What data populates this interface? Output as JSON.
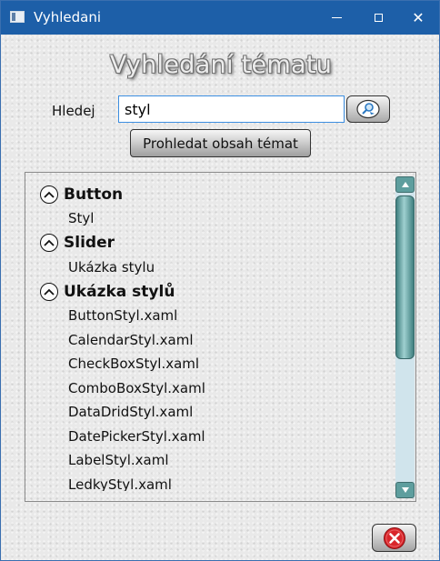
{
  "window": {
    "title": "Vyhledani",
    "controls": {
      "minimize": "minimize",
      "maximize": "maximize",
      "close": "✕"
    }
  },
  "heading": "Vyhledání tématu",
  "search": {
    "label": "Hledej",
    "value": "styl",
    "button_icon": "search-icon"
  },
  "primary_button": "Prohledat obsah témat",
  "tree": {
    "groups": [
      {
        "title": "Button",
        "items": [
          "Styl"
        ]
      },
      {
        "title": "Slider",
        "items": [
          "Ukázka stylu"
        ]
      },
      {
        "title": "Ukázka stylů",
        "items": [
          "ButtonStyl.xaml",
          "CalendarStyl.xaml",
          "CheckBoxStyl.xaml",
          "ComboBoxStyl.xaml",
          "DataDridStyl.xaml",
          "DatePickerStyl.xaml",
          "LabelStyl.xaml",
          "LedkyStyl.xaml"
        ]
      }
    ]
  },
  "exit_button_icon": "close-circle-icon",
  "colors": {
    "titlebar": "#1d5fa8",
    "accent_border": "#3c8ee0",
    "scroll_track": "#d0e4ec",
    "scroll_thumb": "#3f7f7f",
    "exit_red": "#d9262b"
  }
}
